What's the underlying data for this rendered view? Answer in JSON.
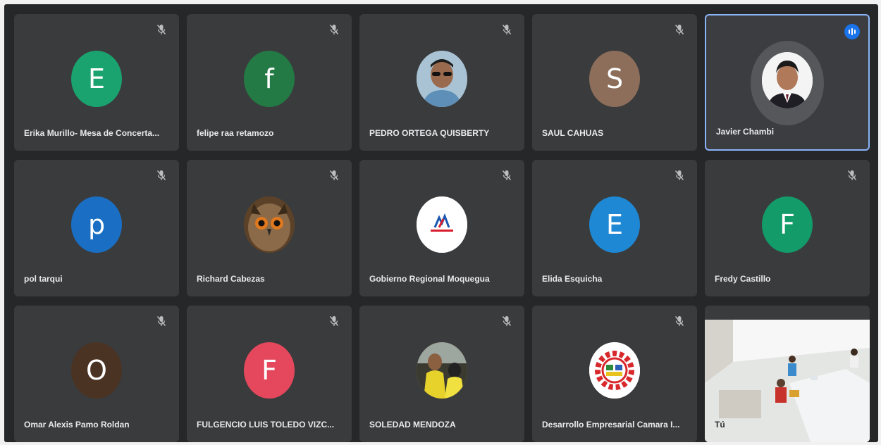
{
  "colors": {
    "background": "#262729",
    "tile": "#3a3b3d",
    "active_border": "#8ab4f8",
    "speaking_badge": "#1a73e8"
  },
  "participants": [
    {
      "name": "Erika Murillo- Mesa de Concerta...",
      "initial": "E",
      "avatar_color": "#1aa36f",
      "muted": true
    },
    {
      "name": "felipe raa retamozo",
      "initial": "f",
      "avatar_color": "#237a45",
      "muted": true
    },
    {
      "name": "PEDRO ORTEGA QUISBERTY",
      "initial": "",
      "avatar_color": "#8a6a52",
      "photo": "man-with-sunglasses-photo",
      "muted": true
    },
    {
      "name": "SAUL CAHUAS",
      "initial": "S",
      "avatar_color": "#8d6e5a",
      "muted": true
    },
    {
      "name": "Javier Chambi",
      "initial": "",
      "avatar_color": "#ffffff",
      "photo": "man-in-suit-photo",
      "muted": false,
      "speaking": true
    },
    {
      "name": "pol tarqui",
      "initial": "p",
      "avatar_color": "#1a6fc4",
      "muted": true
    },
    {
      "name": "Richard Cabezas",
      "initial": "",
      "avatar_color": "#6b4a2a",
      "photo": "owl-photo",
      "muted": true
    },
    {
      "name": "Gobierno Regional Moquegua",
      "initial": "",
      "avatar_color": "#ffffff",
      "photo": "moquegua-logo",
      "muted": true
    },
    {
      "name": "Elida Esquicha",
      "initial": "E",
      "avatar_color": "#1e88d4",
      "muted": true
    },
    {
      "name": "Fredy Castillo",
      "initial": "F",
      "avatar_color": "#139b6a",
      "muted": true
    },
    {
      "name": "Omar Alexis Pamo Roldan",
      "initial": "O",
      "avatar_color": "#4a3322",
      "muted": true
    },
    {
      "name": "FULGENCIO LUIS TOLEDO VIZC...",
      "initial": "F",
      "avatar_color": "#e5485c",
      "muted": true
    },
    {
      "name": "SOLEDAD MENDOZA",
      "initial": "",
      "avatar_color": "#c8b14a",
      "photo": "workers-photo",
      "muted": true
    },
    {
      "name": "Desarrollo Empresarial Camara I...",
      "initial": "",
      "avatar_color": "#ffffff",
      "photo": "chamber-gear-logo",
      "muted": true
    },
    {
      "name": "Tú",
      "initial": "",
      "avatar_color": "#e9ecee",
      "photo": "self-camera-view",
      "muted": false,
      "self": true
    }
  ]
}
